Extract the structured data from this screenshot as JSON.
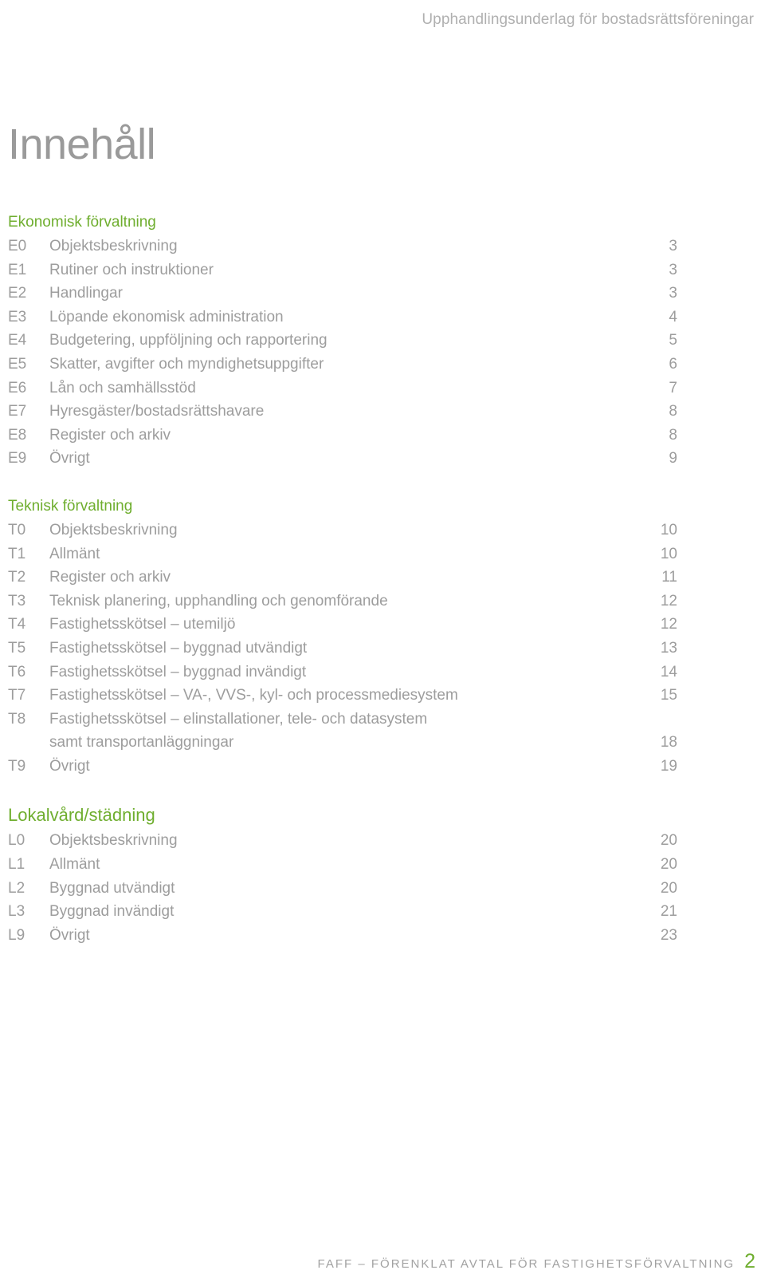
{
  "header": {
    "running_title": "Upphandlingsunderlag för bostadsrättsföreningar"
  },
  "title": "Innehåll",
  "sections": [
    {
      "heading": "Ekonomisk förvaltning",
      "emphasis": "normal",
      "rows": [
        {
          "code": "E0",
          "label": "Objektsbeskrivning",
          "page": "3"
        },
        {
          "code": "E1",
          "label": "Rutiner och instruktioner",
          "page": "3"
        },
        {
          "code": "E2",
          "label": "Handlingar",
          "page": "3"
        },
        {
          "code": "E3",
          "label": "Löpande ekonomisk administration",
          "page": "4"
        },
        {
          "code": "E4",
          "label": "Budgetering, uppföljning och rapportering",
          "page": "5"
        },
        {
          "code": "E5",
          "label": "Skatter, avgifter och myndighetsuppgifter",
          "page": "6"
        },
        {
          "code": "E6",
          "label": "Lån och samhällsstöd",
          "page": "7"
        },
        {
          "code": "E7",
          "label": "Hyresgäster/bostadsrättshavare",
          "page": "8"
        },
        {
          "code": "E8",
          "label": "Register och arkiv",
          "page": "8"
        },
        {
          "code": "E9",
          "label": "Övrigt",
          "page": "9"
        }
      ]
    },
    {
      "heading": "Teknisk förvaltning",
      "emphasis": "normal",
      "rows": [
        {
          "code": "T0",
          "label": "Objektsbeskrivning",
          "page": "10"
        },
        {
          "code": "T1",
          "label": "Allmänt",
          "page": "10"
        },
        {
          "code": "T2",
          "label": "Register och arkiv",
          "page": "11"
        },
        {
          "code": "T3",
          "label": "Teknisk planering, upphandling och genomförande",
          "page": "12"
        },
        {
          "code": "T4",
          "label": "Fastighetsskötsel – utemiljö",
          "page": "12"
        },
        {
          "code": "T5",
          "label": "Fastighetsskötsel – byggnad utvändigt",
          "page": "13"
        },
        {
          "code": "T6",
          "label": "Fastighetsskötsel – byggnad invändigt",
          "page": "14"
        },
        {
          "code": "T7",
          "label": "Fastighetsskötsel – VA-, VVS-, kyl- och processmediesystem",
          "page": "15"
        },
        {
          "code": "T8",
          "label": "Fastighetsskötsel – elinstallationer, tele- och datasystem",
          "page": ""
        },
        {
          "code": "",
          "label": "samt transportanläggningar",
          "page": "18"
        },
        {
          "code": "T9",
          "label": "Övrigt",
          "page": "19"
        }
      ]
    },
    {
      "heading": "Lokalvård/städning",
      "emphasis": "big",
      "rows": [
        {
          "code": "L0",
          "label": "Objektsbeskrivning",
          "page": "20"
        },
        {
          "code": "L1",
          "label": "Allmänt",
          "page": "20"
        },
        {
          "code": "L2",
          "label": "Byggnad utvändigt",
          "page": "20"
        },
        {
          "code": "L3",
          "label": "Byggnad invändigt",
          "page": "21"
        },
        {
          "code": "L9",
          "label": "Övrigt",
          "page": "23"
        }
      ]
    }
  ],
  "footer": {
    "text": "FAFF – FÖRENKLAT AVTAL FÖR FASTIGHETSFÖRVALTNING",
    "page_number": "2"
  },
  "colors": {
    "accent_green": "#6fae2f",
    "body_gray": "#9d9d9d",
    "header_gray": "#b0b0b0",
    "title_gray": "#9a9a9a"
  }
}
